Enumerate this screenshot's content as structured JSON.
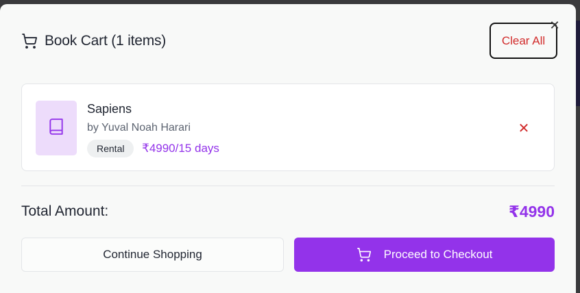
{
  "cart": {
    "title": "Book Cart (1 items)",
    "clear_label": "Clear All",
    "close_glyph": "✕",
    "items": [
      {
        "title": "Sapiens",
        "author": "by Yuval Noah Harari",
        "type": "Rental",
        "price": "₹4990/15 days",
        "remove_glyph": "✕"
      }
    ],
    "total_label": "Total Amount:",
    "total_value": "₹4990",
    "continue_label": "Continue Shopping",
    "checkout_label": "Proceed to Checkout"
  },
  "icons": {
    "header": "shopping-cart-icon",
    "item": "book-icon",
    "checkout": "shopping-cart-icon"
  },
  "colors": {
    "accent": "#9333ea",
    "danger": "#d12a2a",
    "thumb_bg": "#eddcfb"
  }
}
